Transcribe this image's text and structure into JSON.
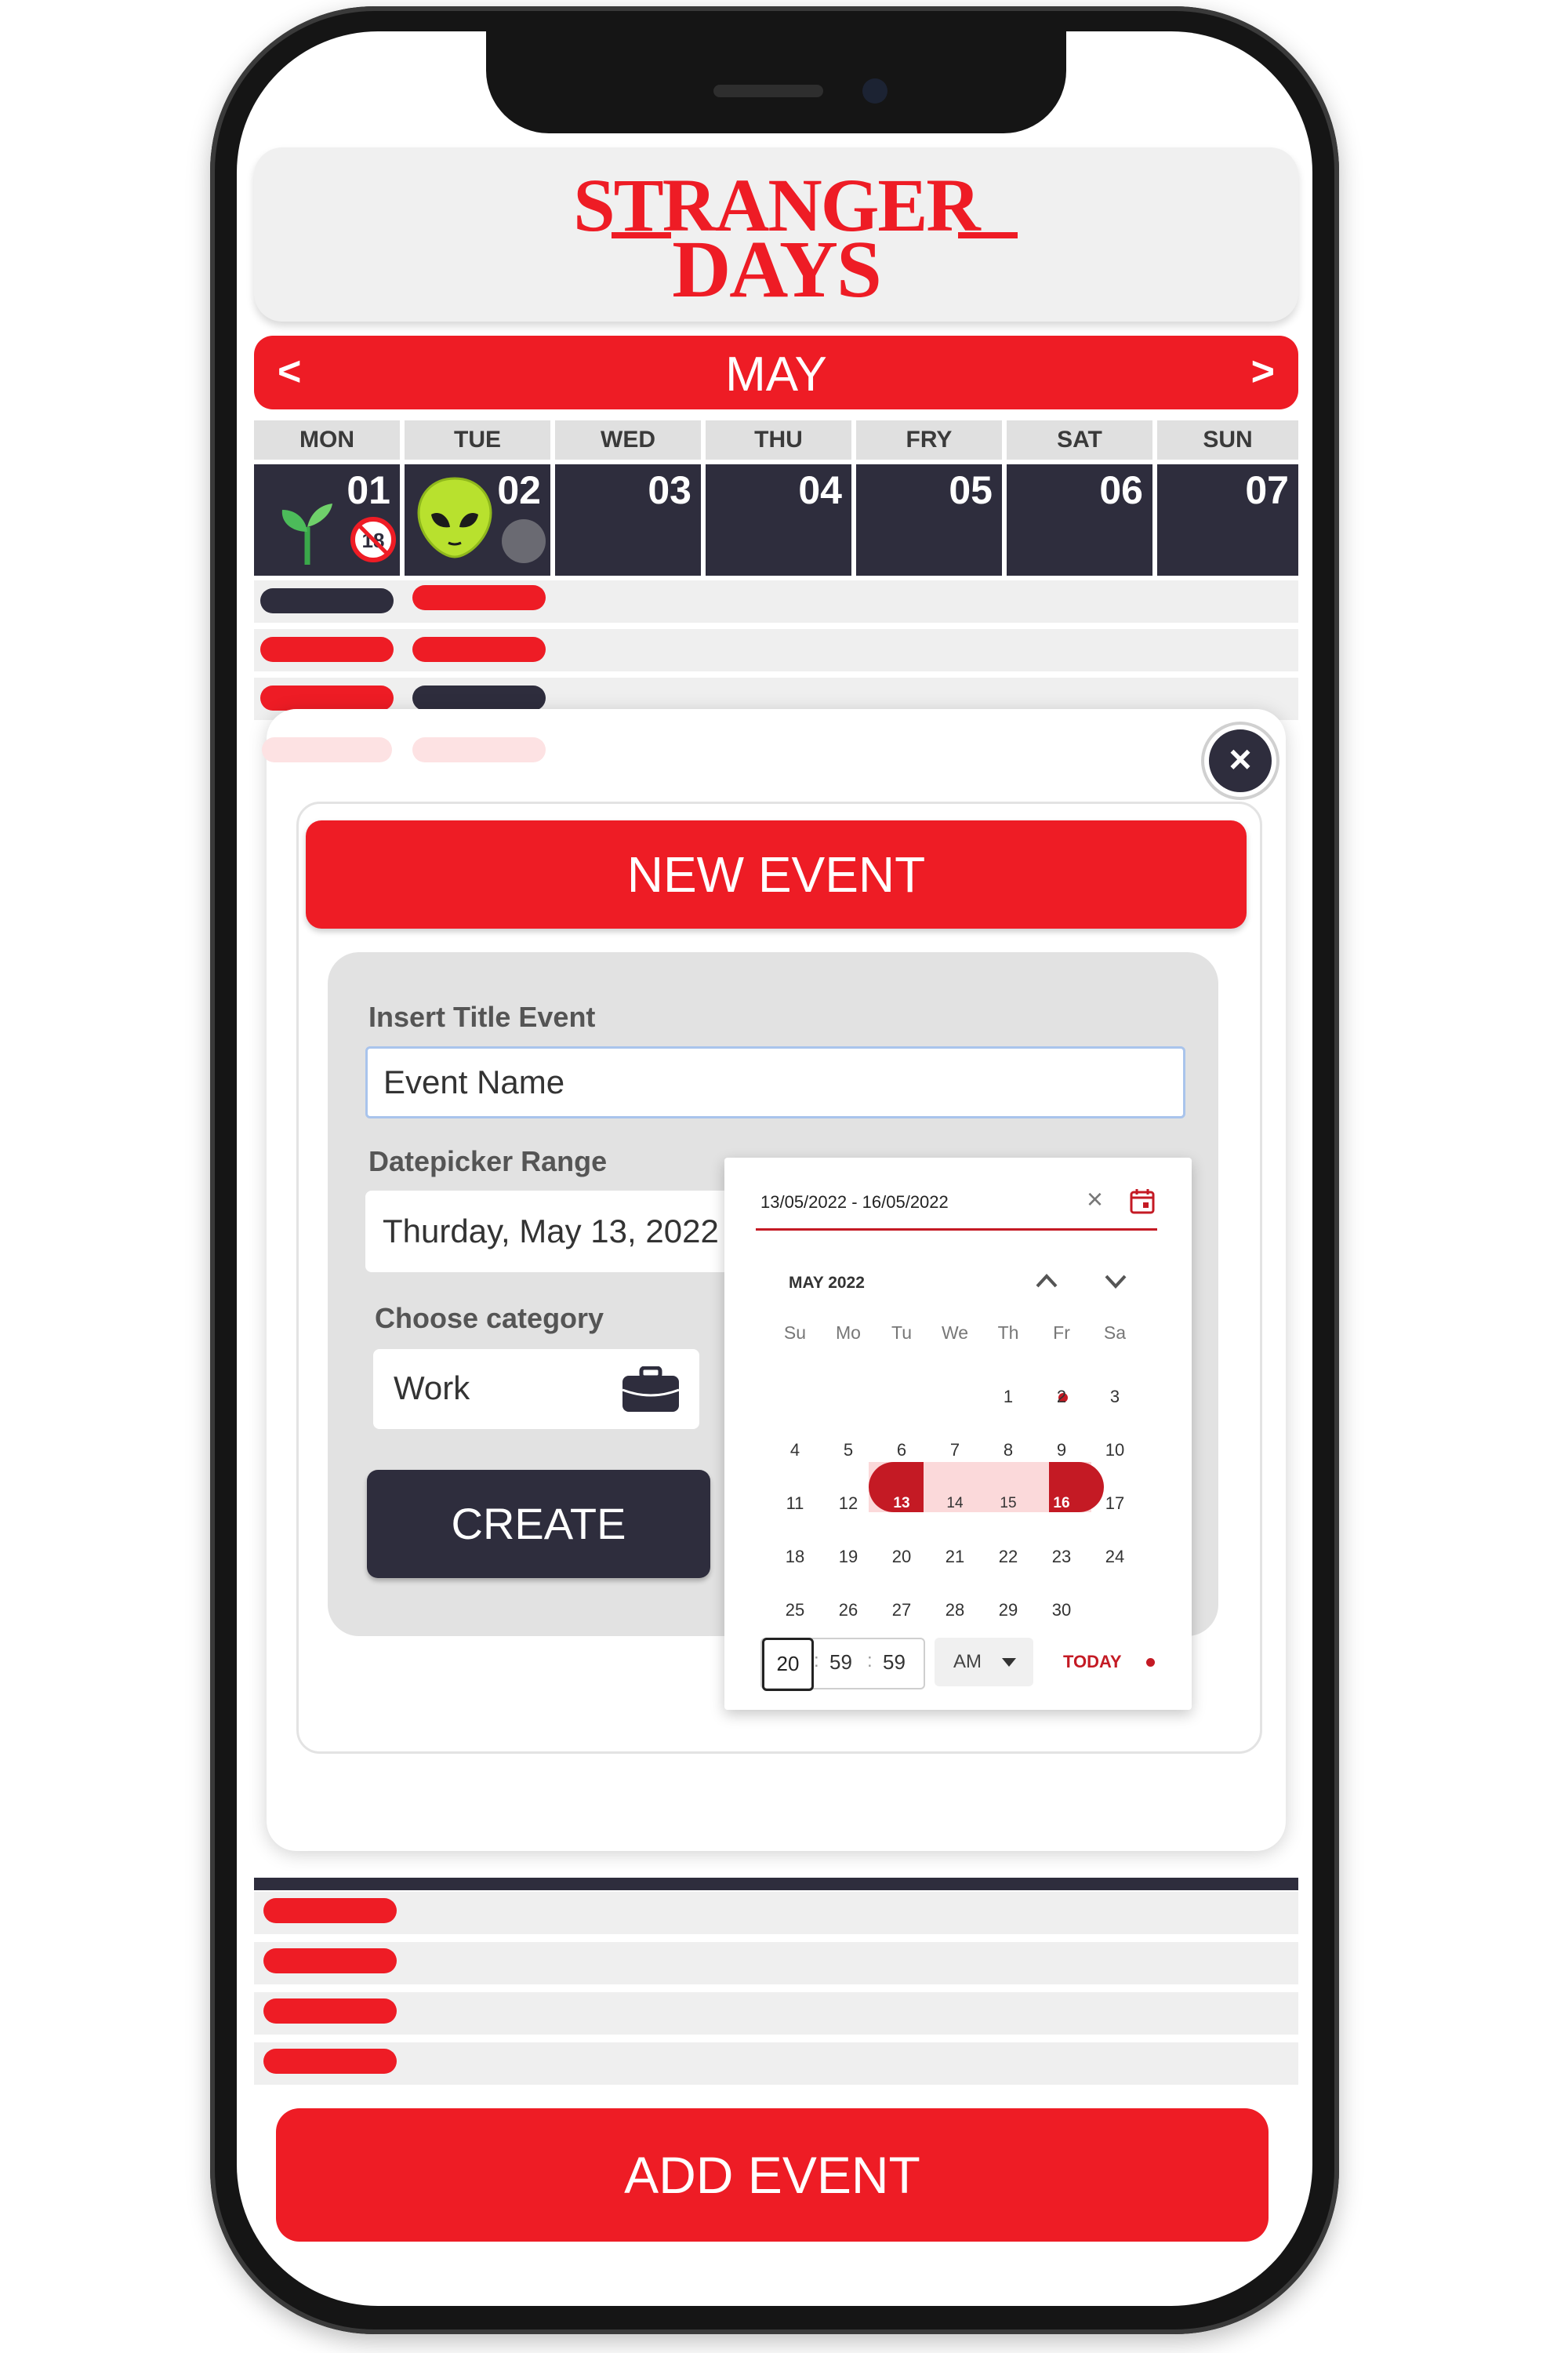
{
  "app": {
    "logo_line1": "STRANGER",
    "logo_line2": "DAYS"
  },
  "calendar": {
    "month": "MAY",
    "prev_label": "<",
    "next_label": ">",
    "weekdays": [
      "MON",
      "TUE",
      "WED",
      "THU",
      "FRY",
      "SAT",
      "SUN"
    ],
    "days": [
      "01",
      "02",
      "03",
      "04",
      "05",
      "06",
      "07"
    ],
    "icons": {
      "mon": [
        "sprout-icon",
        "age-18-restriction-icon"
      ],
      "tue": [
        "alien-icon",
        "gray-dot-icon"
      ]
    }
  },
  "modal": {
    "title": "NEW EVENT",
    "close_label": "×",
    "title_label": "Insert Title Event",
    "title_value": "Event Name",
    "date_label": "Datepicker Range",
    "date_value": "Thurday, May 13, 2022",
    "category_label": "Choose category",
    "category_value": "Work",
    "create_label": "CREATE"
  },
  "datepicker": {
    "range_value": "13/05/2022 - 16/05/2022",
    "month_label": "MAY 2022",
    "weekdays": [
      "Su",
      "Mo",
      "Tu",
      "We",
      "Th",
      "Fr",
      "Sa"
    ],
    "weeks": [
      [
        "",
        "",
        "",
        "",
        "1",
        "2",
        "3"
      ],
      [
        "4",
        "5",
        "6",
        "7",
        "8",
        "9",
        "10"
      ],
      [
        "11",
        "12",
        "13",
        "14",
        "15",
        "16",
        "17"
      ],
      [
        "18",
        "19",
        "20",
        "21",
        "22",
        "23",
        "24"
      ],
      [
        "25",
        "26",
        "27",
        "28",
        "29",
        "30",
        ""
      ]
    ],
    "range_start": "13",
    "range_end": "16",
    "time_hh": "20",
    "time_mm": "59",
    "time_ss": "59",
    "ampm": "AM",
    "today_label": "TODAY"
  },
  "footer": {
    "add_event_label": "ADD EVENT"
  },
  "colors": {
    "brand_red": "#ee1c25",
    "dark": "#2e2d3d",
    "accent_red": "#c41a24"
  }
}
